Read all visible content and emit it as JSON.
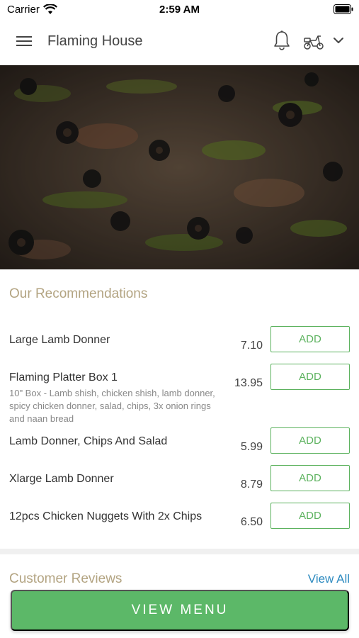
{
  "status_bar": {
    "carrier": "Carrier",
    "time": "2:59 AM"
  },
  "header": {
    "title": "Flaming House"
  },
  "recommendations": {
    "title": "Our Recommendations",
    "add_label": "ADD",
    "items": [
      {
        "name": "Large Lamb Donner",
        "price": "7.10",
        "description": ""
      },
      {
        "name": "Flaming Platter Box 1",
        "price": "13.95",
        "description": "10\" Box - Lamb shish, chicken shish, lamb donner, spicy chicken donner, salad, chips, 3x onion rings and naan bread"
      },
      {
        "name": "Lamb Donner, Chips And Salad",
        "price": "5.99",
        "description": ""
      },
      {
        "name": "Xlarge Lamb Donner",
        "price": "8.79",
        "description": ""
      },
      {
        "name": "12pcs Chicken Nuggets With 2x Chips",
        "price": "6.50",
        "description": ""
      }
    ]
  },
  "reviews": {
    "title": "Customer Reviews",
    "view_all": "View All"
  },
  "footer": {
    "view_menu": "VIEW MENU"
  },
  "colors": {
    "accent_green": "#5cb868",
    "section_title": "#b3a482",
    "link_blue": "#2e8bc0"
  },
  "icons": [
    "wifi-icon",
    "battery-icon",
    "hamburger-menu-icon",
    "bell-icon",
    "scooter-icon",
    "chevron-down-icon"
  ]
}
